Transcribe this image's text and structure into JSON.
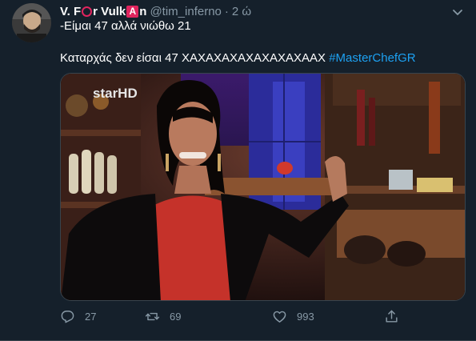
{
  "author": {
    "display_name_part1": "V. F",
    "display_name_part2": "r Vulk",
    "display_name_part3": "n",
    "emoji_letter": "A",
    "handle": "@tim_inferno",
    "separator": "·",
    "time": "2 ώ"
  },
  "tweet": {
    "line1": "-Είμαι 47 αλλά νιώθω 21",
    "line2_text": "Καταρχάς δεν είσαι 47 ΧΑΧΑΧΑΧΑΧΑΧΑΧΑΧΑΑΧ ",
    "hashtag": "#MasterChefGR"
  },
  "media": {
    "watermark": "starHD"
  },
  "actions": {
    "replies": "27",
    "retweets": "69",
    "likes": "993"
  },
  "colors": {
    "background": "#15202b",
    "text": "#ffffff",
    "secondary": "#8899a6",
    "link": "#1da1f2",
    "emoji_red": "#e0245e"
  },
  "icons": [
    "avatar",
    "chevron-down-icon",
    "reply-icon",
    "retweet-icon",
    "like-icon",
    "share-icon"
  ]
}
